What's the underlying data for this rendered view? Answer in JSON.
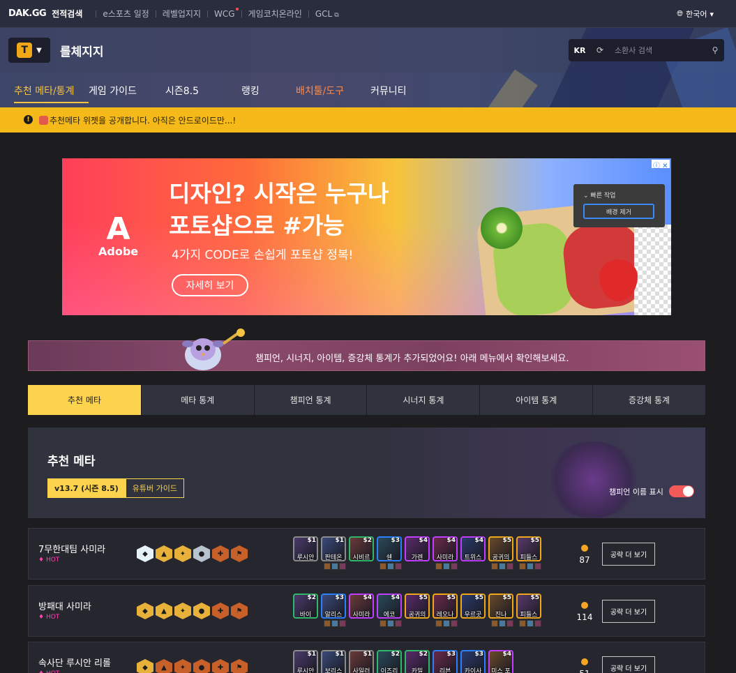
{
  "topbar": {
    "logo": "DAK.GG",
    "brand_sub": "전적검색",
    "links": [
      "e스포츠 일정",
      "레벨업지지",
      "WCG",
      "게임코치온라인",
      "GCL"
    ],
    "language": "한국어"
  },
  "header": {
    "game_logo_text": "T",
    "title": "롤체지지",
    "region": "KR",
    "search_placeholder": "소환사 검색",
    "nav": [
      {
        "label": "추천 메타/통계",
        "state": "active"
      },
      {
        "label": "게임 가이드",
        "state": "normal"
      },
      {
        "label": "시즌8.5",
        "state": "normal"
      },
      {
        "label": "랭킹",
        "state": "normal"
      },
      {
        "label": "배치툴/도구",
        "state": "orange"
      },
      {
        "label": "커뮤니티",
        "state": "normal"
      }
    ]
  },
  "notice": {
    "text": "추천메타 위젯을 공개합니다. 아직은 안드로이드만...!"
  },
  "ad": {
    "brand": "Adobe",
    "brand_mark": "A",
    "headline_1": "디자인? 시작은 누구나",
    "headline_2": "포토샵으로 #가능",
    "subline": "4가지 CODE로 손쉽게 포토샵 정복!",
    "button": "자세히 보기",
    "panel_title": "빠른 작업",
    "panel_button": "배경 제거",
    "adchoice": "ⓘ ✕"
  },
  "banner": {
    "text": "챔피언, 시너지, 아이템, 증강체 통계가 추가되었어요! 아래 메뉴에서 확인해보세요."
  },
  "tabs": [
    "추천 메타",
    "메타 통계",
    "챔피언 통계",
    "시너지 통계",
    "아이템 통계",
    "증강체 통계"
  ],
  "meta": {
    "title": "추천 메타",
    "version_on": "v13.7 (시즌 8.5)",
    "version_off": "유튜버 가이드",
    "toggle_label": "챔피언 이름 표시"
  },
  "comps": [
    {
      "name": "7무한대팀 사미라",
      "hot": "HOT",
      "traits": [
        "prism",
        "gold",
        "gold",
        "silver",
        "bronze",
        "bronze"
      ],
      "champs": [
        {
          "name": "루시안",
          "cost": "$1",
          "tier": 1
        },
        {
          "name": "판테온",
          "cost": "$1",
          "tier": 1
        },
        {
          "name": "시비르",
          "cost": "$2",
          "tier": 2
        },
        {
          "name": "쉔",
          "cost": "$3",
          "tier": 3
        },
        {
          "name": "가렌",
          "cost": "$4",
          "tier": 4
        },
        {
          "name": "사미라",
          "cost": "$4",
          "tier": 4
        },
        {
          "name": "트위스",
          "cost": "$4",
          "tier": 4
        },
        {
          "name": "공귀의",
          "cost": "$5",
          "tier": 5
        },
        {
          "name": "피들스",
          "cost": "$5",
          "tier": 5
        }
      ],
      "count": "87",
      "button": "공략 더 보기"
    },
    {
      "name": "방패대 사미라",
      "hot": "HOT",
      "traits": [
        "gold",
        "gold",
        "gold",
        "gold",
        "bronze",
        "bronze"
      ],
      "champs": [
        {
          "name": "바이",
          "cost": "$2",
          "tier": 2
        },
        {
          "name": "알리스",
          "cost": "$3",
          "tier": 3
        },
        {
          "name": "사미라",
          "cost": "$4",
          "tier": 4
        },
        {
          "name": "에코",
          "cost": "$4",
          "tier": 4
        },
        {
          "name": "공귀의",
          "cost": "$5",
          "tier": 5
        },
        {
          "name": "레오나",
          "cost": "$5",
          "tier": 5
        },
        {
          "name": "우르곳",
          "cost": "$5",
          "tier": 5
        },
        {
          "name": "진나",
          "cost": "$5",
          "tier": 5
        },
        {
          "name": "피들스",
          "cost": "$5",
          "tier": 5
        }
      ],
      "count": "114",
      "button": "공략 더 보기"
    },
    {
      "name": "속사단 루시안 리롤",
      "hot": "HOT",
      "traits": [
        "gold",
        "bronze",
        "bronze",
        "bronze",
        "bronze",
        "bronze"
      ],
      "champs": [
        {
          "name": "루시안",
          "cost": "$1",
          "tier": 1
        },
        {
          "name": "보리스",
          "cost": "$1",
          "tier": 1
        },
        {
          "name": "사일러",
          "cost": "$1",
          "tier": 1
        },
        {
          "name": "이즈리",
          "cost": "$2",
          "tier": 2
        },
        {
          "name": "카밀",
          "cost": "$2",
          "tier": 2
        },
        {
          "name": "리븐",
          "cost": "$3",
          "tier": 3
        },
        {
          "name": "카이사",
          "cost": "$3",
          "tier": 3
        },
        {
          "name": "미스 포",
          "cost": "$4",
          "tier": 4
        }
      ],
      "count": "51",
      "button": "공략 더 보기"
    }
  ]
}
